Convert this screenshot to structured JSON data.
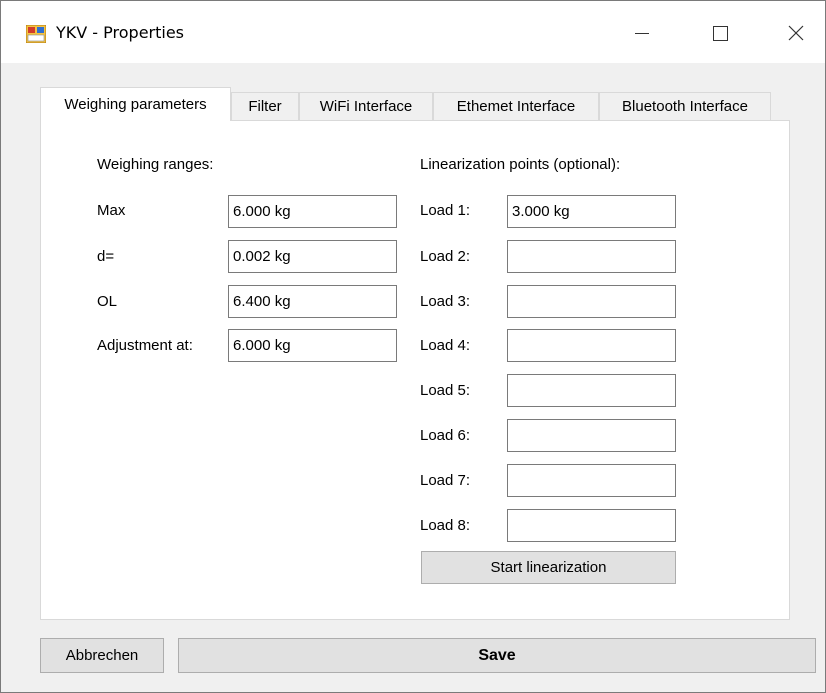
{
  "window": {
    "title": "YKV - Properties"
  },
  "tabs": [
    {
      "label": "Weighing parameters"
    },
    {
      "label": "Filter"
    },
    {
      "label": "WiFi Interface"
    },
    {
      "label": "Ethemet Interface"
    },
    {
      "label": "Bluetooth Interface"
    }
  ],
  "weighing": {
    "heading": "Weighing ranges:",
    "max_label": "Max",
    "max_value": "6.000 kg",
    "d_label": "d=",
    "d_value": "0.002 kg",
    "ol_label": "OL",
    "ol_value": "6.400 kg",
    "adj_label": "Adjustment at:",
    "adj_value": "6.000 kg"
  },
  "linearization": {
    "heading": "Linearization points (optional):",
    "loads": [
      {
        "label": "Load 1:",
        "value": "3.000 kg"
      },
      {
        "label": "Load 2:",
        "value": ""
      },
      {
        "label": "Load 3:",
        "value": ""
      },
      {
        "label": "Load 4:",
        "value": ""
      },
      {
        "label": "Load 5:",
        "value": ""
      },
      {
        "label": "Load 6:",
        "value": ""
      },
      {
        "label": "Load 7:",
        "value": ""
      },
      {
        "label": "Load 8:",
        "value": ""
      }
    ],
    "start_label": "Start linearization"
  },
  "footer": {
    "cancel_label": "Abbrechen",
    "save_label": "Save"
  }
}
